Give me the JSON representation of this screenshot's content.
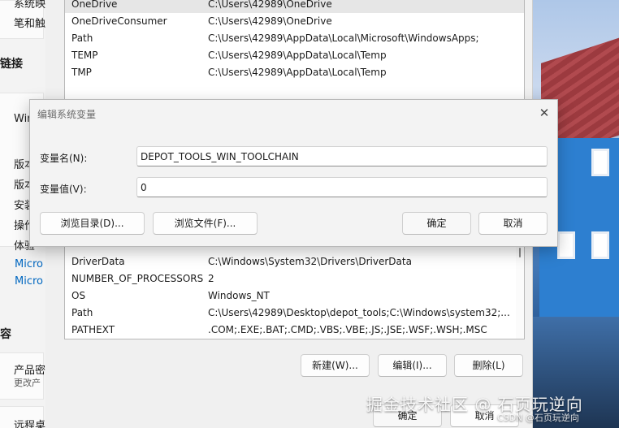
{
  "settings": {
    "items": [
      "系统映",
      "笔和触",
      "链接",
      "Win",
      "版本",
      "版本",
      "安装",
      "操作",
      "体验"
    ],
    "links": [
      "Micro",
      "Micro"
    ],
    "section_header": "容",
    "product_key": "产品密",
    "product_key_sub": "更改产",
    "remote": "远程桌"
  },
  "user_vars": {
    "rows": [
      {
        "name": "OneDrive",
        "value": "C:\\Users\\42989\\OneDrive"
      },
      {
        "name": "OneDriveConsumer",
        "value": "C:\\Users\\42989\\OneDrive"
      },
      {
        "name": "Path",
        "value": "C:\\Users\\42989\\AppData\\Local\\Microsoft\\WindowsApps;"
      },
      {
        "name": "TEMP",
        "value": "C:\\Users\\42989\\AppData\\Local\\Temp"
      },
      {
        "name": "TMP",
        "value": "C:\\Users\\42989\\AppData\\Local\\Temp"
      }
    ]
  },
  "system_vars": {
    "rows": [
      {
        "name": "DriverData",
        "value": "C:\\Windows\\System32\\Drivers\\DriverData"
      },
      {
        "name": "NUMBER_OF_PROCESSORS",
        "value": "2"
      },
      {
        "name": "OS",
        "value": "Windows_NT"
      },
      {
        "name": "Path",
        "value": "C:\\Users\\42989\\Desktop\\depot_tools;C:\\Windows\\system32;..."
      },
      {
        "name": "PATHEXT",
        "value": ".COM;.EXE;.BAT;.CMD;.VBS;.VBE;.JS;.JSE;.WSF;.WSH;.MSC"
      }
    ],
    "buttons": {
      "new": "新建(W)...",
      "edit": "编辑(I)...",
      "delete": "删除(L)"
    }
  },
  "footer_buttons": {
    "ok": "确定",
    "cancel": "取消"
  },
  "dialog": {
    "title": "编辑系统变量",
    "close_glyph": "✕",
    "name_label": "变量名(N):",
    "name_value": "DEPOT_TOOLS_WIN_TOOLCHAIN",
    "value_label": "变量值(V):",
    "value_value": "0",
    "browse_dir": "浏览目录(D)...",
    "browse_file": "浏览文件(F)...",
    "ok": "确定",
    "cancel": "取消"
  },
  "watermark": {
    "main": "掘金技术社区 @ 石页玩逆向",
    "sub": "CSDN @石页玩逆向"
  }
}
